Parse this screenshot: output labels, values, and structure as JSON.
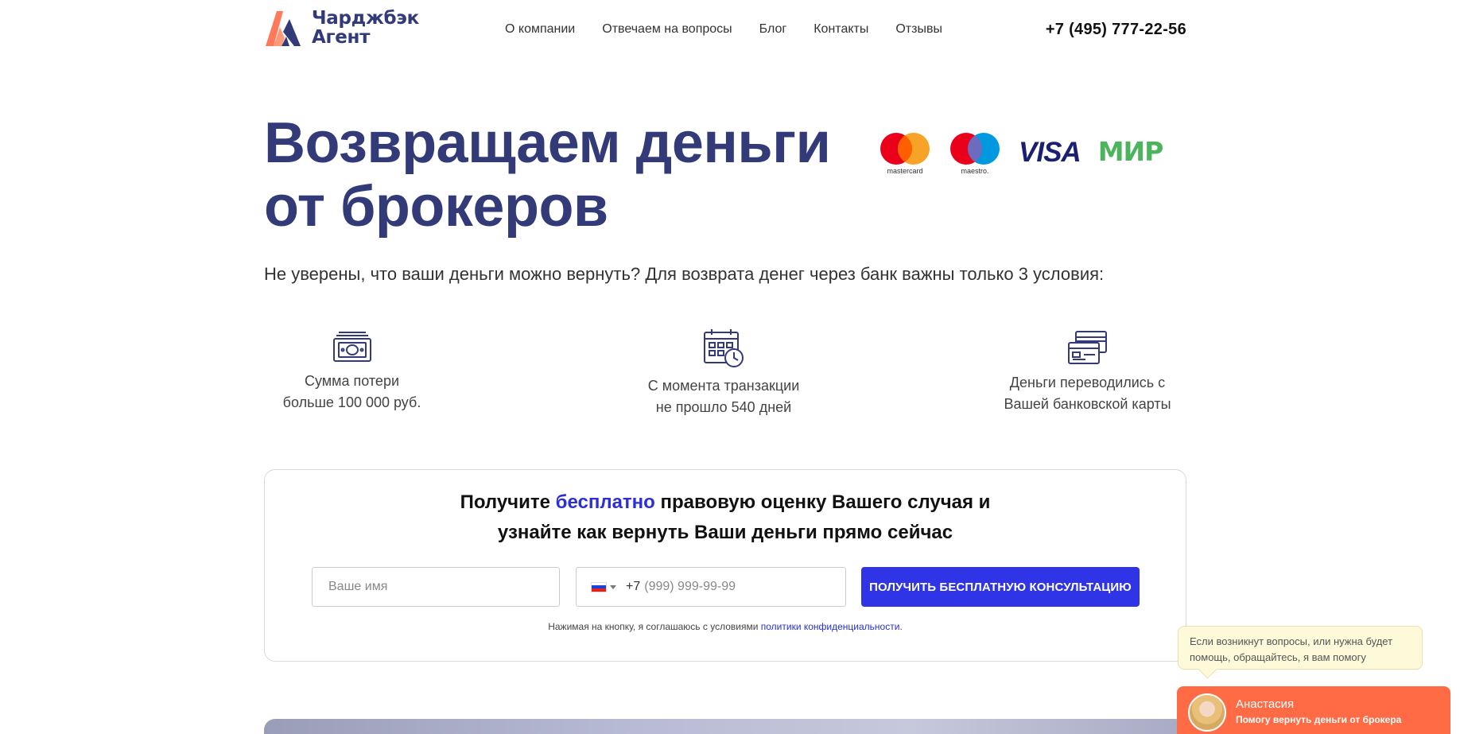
{
  "header": {
    "logo_line1": "Чарджбэк",
    "logo_line2": "Агент",
    "nav": [
      "О компании",
      "Отвечаем на вопросы",
      "Блог",
      "Контакты",
      "Отзывы"
    ],
    "phone": "+7 (495) 777-22-56"
  },
  "hero": {
    "title_line1": "Возвращаем деньги",
    "title_line2": "от брокеров",
    "subtitle": "Не уверены, что ваши деньги можно вернуть? Для возврата денег через банк важны только 3 условия:"
  },
  "payment_logos": {
    "mastercard": "mastercard",
    "maestro": "maestro.",
    "visa": "VISA",
    "mir": "МИР",
    "colors": {
      "mc_red": "#eb001b",
      "mc_orange": "#f79e1b",
      "maestro_blue": "#0099df",
      "visa_blue": "#1a1f71",
      "mir_green": "#4db45e"
    }
  },
  "conditions": [
    {
      "icon": "money-icon",
      "line1": "Сумма потери",
      "line2": "больше 100 000 руб."
    },
    {
      "icon": "calendar-clock-icon",
      "line1": "С момента транзакции",
      "line2": "не прошло 540 дней"
    },
    {
      "icon": "bank-card-icon",
      "line1": "Деньги переводились с",
      "line2": "Вашей банковской карты"
    }
  ],
  "form": {
    "title_part1": "Получите ",
    "title_highlight": "бесплатно",
    "title_part2": " правовую оценку Вашего случая и",
    "title_line2": "узнайте как вернуть Ваши деньги прямо сейчас",
    "name_placeholder": "Ваше имя",
    "phone_code": "+7",
    "phone_placeholder": "(999) 999-99-99",
    "submit_label": "ПОЛУЧИТЬ БЕСПЛАТНУЮ КОНСУЛЬТАЦИЮ",
    "agree_text": "Нажимая на кнопку, я соглашаюсь с условиями ",
    "agree_link": "политики конфиденциальности",
    "agree_end": "."
  },
  "chat": {
    "bubble_text": "Если возникнут вопросы, или нужна будет помощь, обращайтесь, я вам помогу",
    "agent_name": "Анастасия",
    "agent_subtitle": "Помогу вернуть деньги от брокера"
  },
  "colors": {
    "brand": "#323a78",
    "accent_button": "#2f34e6",
    "chat": "#ff6b45"
  }
}
